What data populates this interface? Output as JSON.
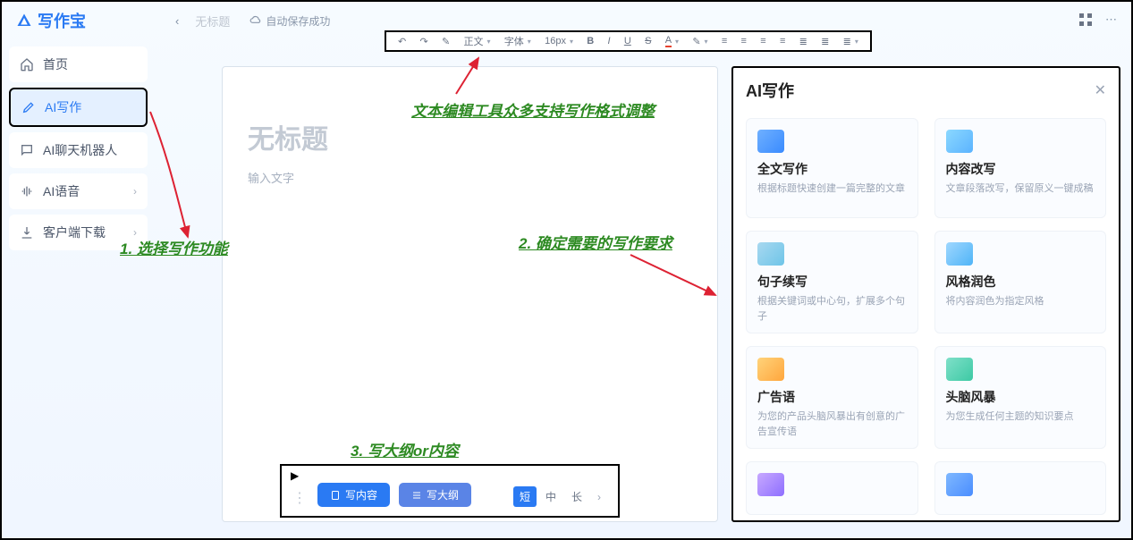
{
  "header": {
    "logo_text": "写作宝",
    "tab_label": "无标题",
    "autosave_text": "自动保存成功"
  },
  "sidebar": {
    "items": [
      {
        "label": "首页"
      },
      {
        "label": "AI写作"
      },
      {
        "label": "AI聊天机器人"
      },
      {
        "label": "AI语音"
      },
      {
        "label": "客户端下载"
      }
    ]
  },
  "toolbar": {
    "format_text": "正文",
    "font_text": "字体",
    "size_text": "16px"
  },
  "editor": {
    "title_placeholder": "无标题",
    "body_placeholder": "输入文字"
  },
  "quickbar": {
    "write_content": "写内容",
    "write_outline": "写大纲",
    "len_short": "短",
    "len_mid": "中",
    "len_long": "长"
  },
  "panel": {
    "title": "AI写作",
    "cards": [
      {
        "title": "全文写作",
        "desc": "根据标题快速创建一篇完整的文章"
      },
      {
        "title": "内容改写",
        "desc": "文章段落改写，保留原义一键成稿"
      },
      {
        "title": "句子续写",
        "desc": "根据关键词或中心句，扩展多个句子"
      },
      {
        "title": "风格润色",
        "desc": "将内容润色为指定风格"
      },
      {
        "title": "广告语",
        "desc": "为您的产品头脑风暴出有创意的广告宣传语"
      },
      {
        "title": "头脑风暴",
        "desc": "为您生成任何主题的知识要点"
      }
    ]
  },
  "annotations": {
    "a1": "1. 选择写作功能",
    "a2": "2. 确定需要的写作要求",
    "a3": "3. 写大纲or内容",
    "a_toolbar": "文本编辑工具众多支持写作格式调整"
  }
}
